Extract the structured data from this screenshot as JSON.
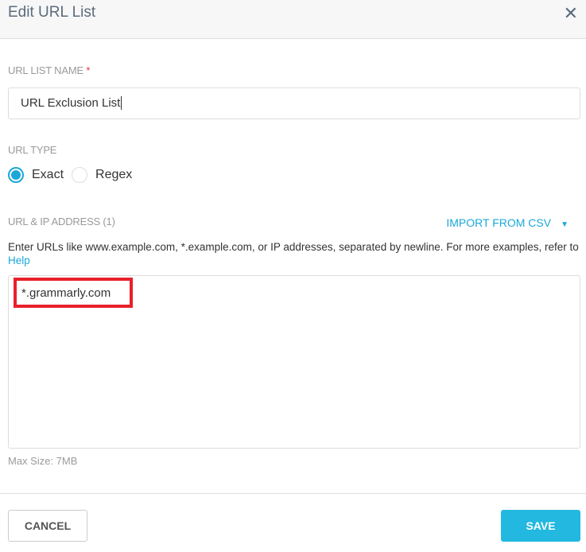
{
  "dialog": {
    "title": "Edit URL List",
    "close_icon": "close-icon"
  },
  "name_field": {
    "label": "URL LIST NAME",
    "required_mark": "*",
    "value": "URL Exclusion List"
  },
  "url_type": {
    "label": "URL TYPE",
    "options": [
      {
        "label": "Exact",
        "selected": true
      },
      {
        "label": "Regex",
        "selected": false
      }
    ]
  },
  "urls": {
    "label": "URL & IP ADDRESS (1)",
    "import_label": "IMPORT FROM CSV",
    "help_text": "Enter URLs like www.example.com, *.example.com, or IP addresses, separated by newline. For more examples, refer to",
    "help_link": "Help",
    "entries": [
      "*.grammarly.com"
    ],
    "max_size": "Max Size: 7MB"
  },
  "footer": {
    "cancel": "CANCEL",
    "save": "SAVE"
  },
  "colors": {
    "accent": "#1ba8d9",
    "highlight": "#e8202a"
  }
}
